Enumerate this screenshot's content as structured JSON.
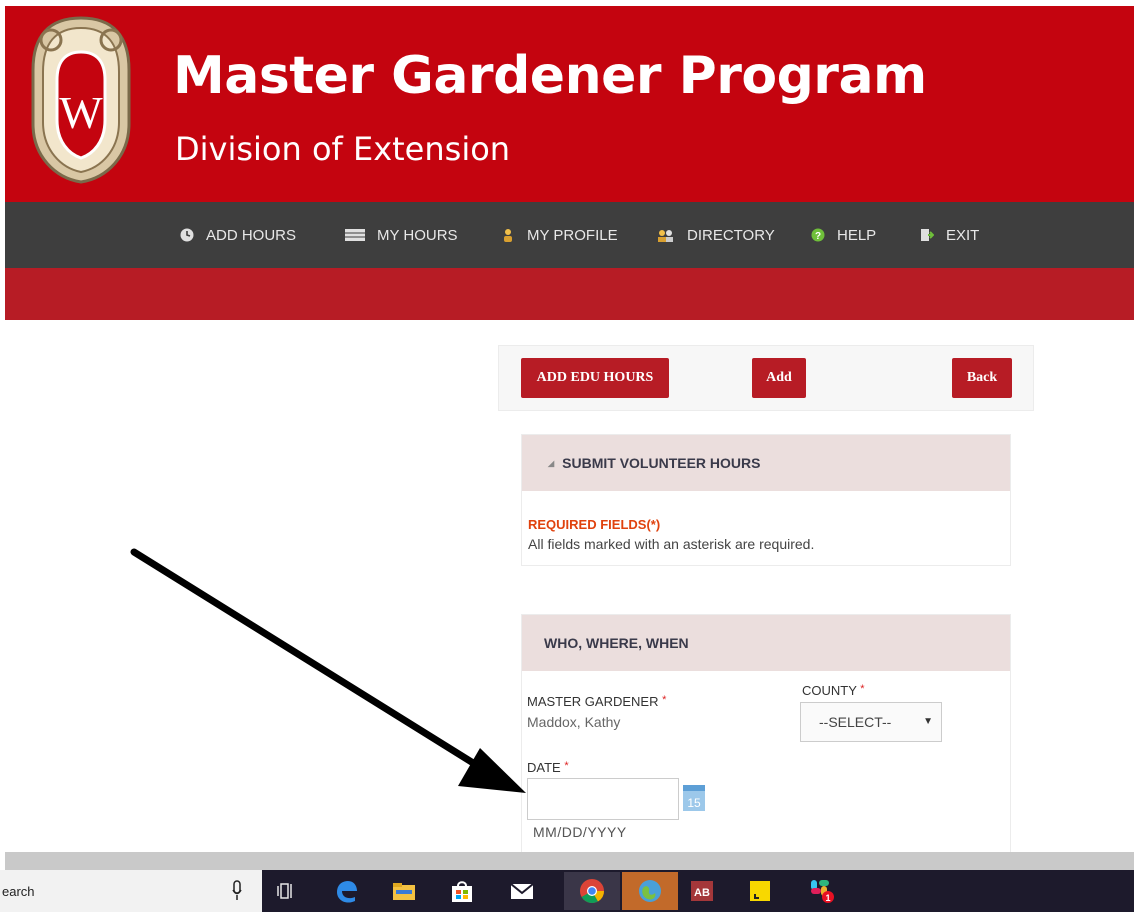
{
  "header": {
    "title": "Master Gardener Program",
    "subtitle": "Division of Extension",
    "logo_letter": "W"
  },
  "nav": {
    "items": [
      {
        "label": "ADD HOURS",
        "icon": "clock-icon"
      },
      {
        "label": "MY HOURS",
        "icon": "table-icon"
      },
      {
        "label": "MY PROFILE",
        "icon": "person-icon"
      },
      {
        "label": "DIRECTORY",
        "icon": "people-icon"
      },
      {
        "label": "HELP",
        "icon": "help-icon"
      },
      {
        "label": "EXIT",
        "icon": "exit-icon"
      }
    ]
  },
  "toolbar": {
    "add_edu_label": "ADD EDU HOURS",
    "add_label": "Add",
    "back_label": "Back"
  },
  "submit_panel": {
    "title": "SUBMIT VOLUNTEER HOURS",
    "collapse_glyph": "◢",
    "required_title": "REQUIRED FIELDS(*)",
    "required_text": "All fields marked with an asterisk are required."
  },
  "who_panel": {
    "title": "WHO, WHERE, WHEN",
    "gardener_label": "MASTER GARDENER",
    "gardener_value": "Maddox, Kathy",
    "county_label": "COUNTY",
    "county_selected": "--SELECT--",
    "date_label": "DATE",
    "date_value": "",
    "date_hint": "MM/DD/YYYY",
    "calendar_day": "15",
    "asterisk": "*"
  },
  "taskbar": {
    "search_text": "earch",
    "icons": [
      "task-view-icon",
      "edge-icon",
      "file-explorer-icon",
      "store-icon",
      "mail-icon",
      "chrome-icon",
      "browser-icon",
      "access-icon",
      "sticky-notes-icon",
      "slack-icon"
    ],
    "slack_badge": "1"
  },
  "colors": {
    "brand_red": "#c4040f",
    "button_red": "#b71c25",
    "nav_dark": "#3e3e3e",
    "panel_head": "#ebdedd",
    "required_orange": "#e0420e"
  }
}
